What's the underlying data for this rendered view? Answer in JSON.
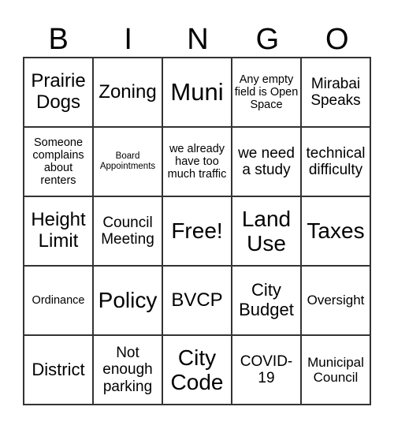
{
  "header": {
    "letters": [
      "B",
      "I",
      "N",
      "G",
      "O"
    ]
  },
  "board": {
    "rows": [
      [
        "Prairie Dogs",
        "Zoning",
        "Muni",
        "Any empty field is Open Space",
        "Mirabai Speaks"
      ],
      [
        "Someone complains about renters",
        "Board Appointments",
        "we already have too much traffic",
        "we need a study",
        "technical difficulty"
      ],
      [
        "Height Limit",
        "Council Meeting",
        "Free!",
        "Land Use",
        "Taxes"
      ],
      [
        "Ordinance",
        "Policy",
        "BVCP",
        "City Budget",
        "Oversight"
      ],
      [
        "District",
        "Not enough parking",
        "City Code",
        "COVID-19",
        "Municipal Council"
      ]
    ]
  },
  "colors": {
    "grid_line": "#333333",
    "background": "#ffffff",
    "text": "#000000"
  }
}
